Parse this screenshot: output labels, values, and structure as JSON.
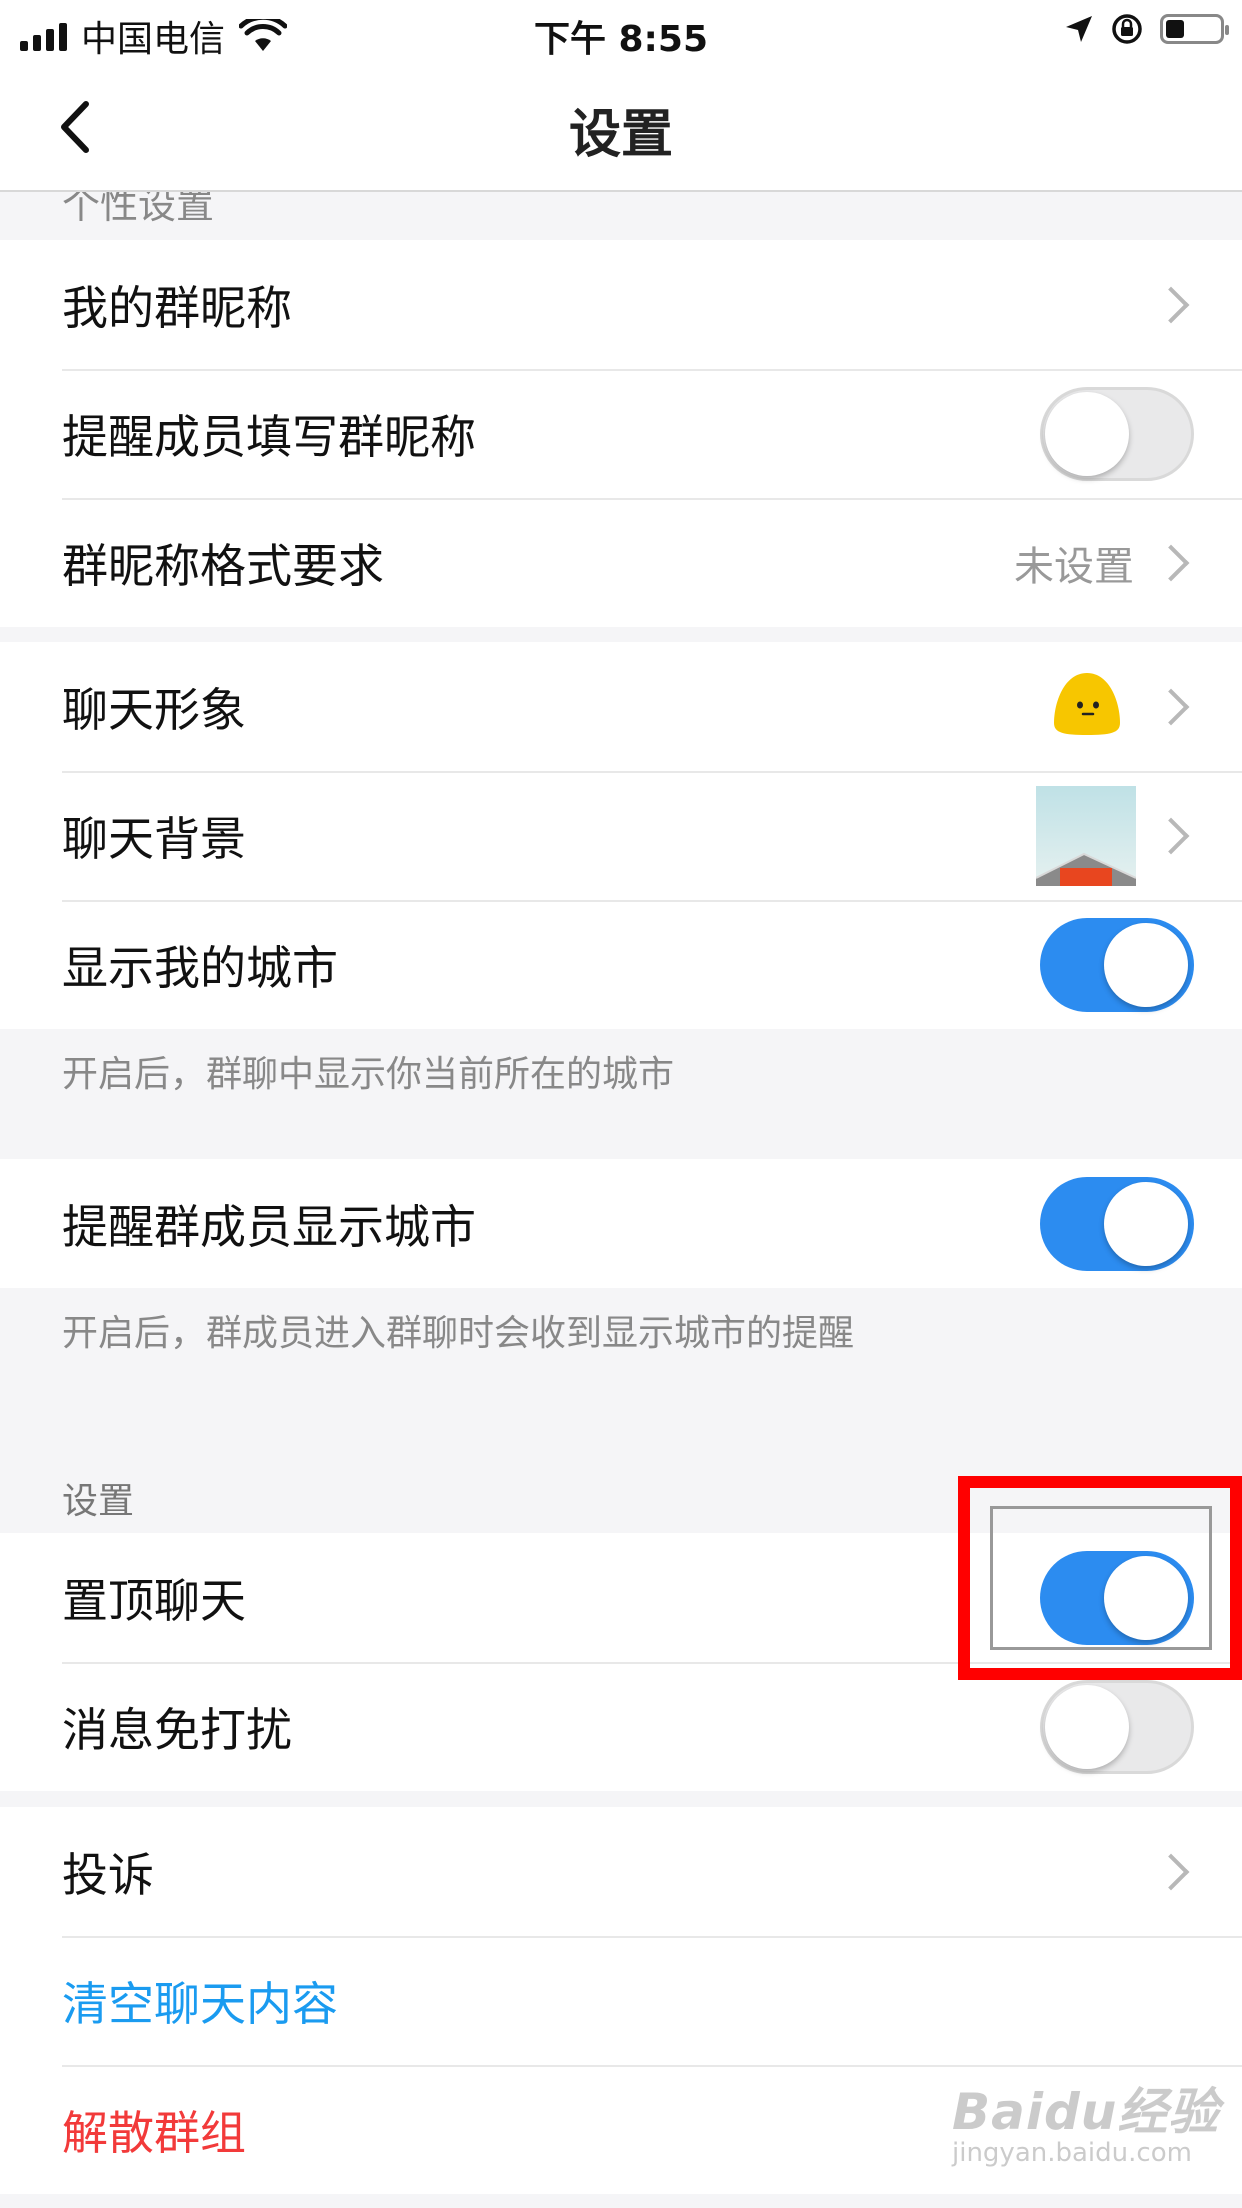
{
  "status_bar": {
    "carrier": "中国电信",
    "time": "下午 8:55"
  },
  "nav": {
    "title": "设置"
  },
  "sections": {
    "personal_header": "个性设置",
    "group_nickname": "我的群昵称",
    "remind_nickname": "提醒成员填写群昵称",
    "remind_nickname_on": false,
    "nickname_format": "群昵称格式要求",
    "nickname_format_value": "未设置",
    "chat_avatar": "聊天形象",
    "chat_background": "聊天背景",
    "show_city": "显示我的城市",
    "show_city_on": true,
    "show_city_desc": "开启后，群聊中显示你当前所在的城市",
    "remind_city": "提醒群成员显示城市",
    "remind_city_on": true,
    "remind_city_desc": "开启后，群成员进入群聊时会收到显示城市的提醒",
    "settings_header": "设置",
    "pin_chat": "置顶聊天",
    "pin_chat_on": true,
    "do_not_disturb": "消息免打扰",
    "do_not_disturb_on": false,
    "report": "投诉",
    "clear_chat": "清空聊天内容",
    "dissolve_group": "解散群组"
  },
  "colors": {
    "toggle_on": "#2c8cf0",
    "link_blue": "#1a9bf0",
    "danger_red": "#f23a3a",
    "highlight": "#ff0000"
  },
  "icons": [
    "signal-icon",
    "wifi-icon",
    "location-arrow-icon",
    "rotation-lock-icon",
    "battery-icon",
    "back-chevron-icon",
    "chevron-right-icon"
  ],
  "watermark": {
    "brand": "Baidu经验",
    "url": "jingyan.baidu.com"
  }
}
